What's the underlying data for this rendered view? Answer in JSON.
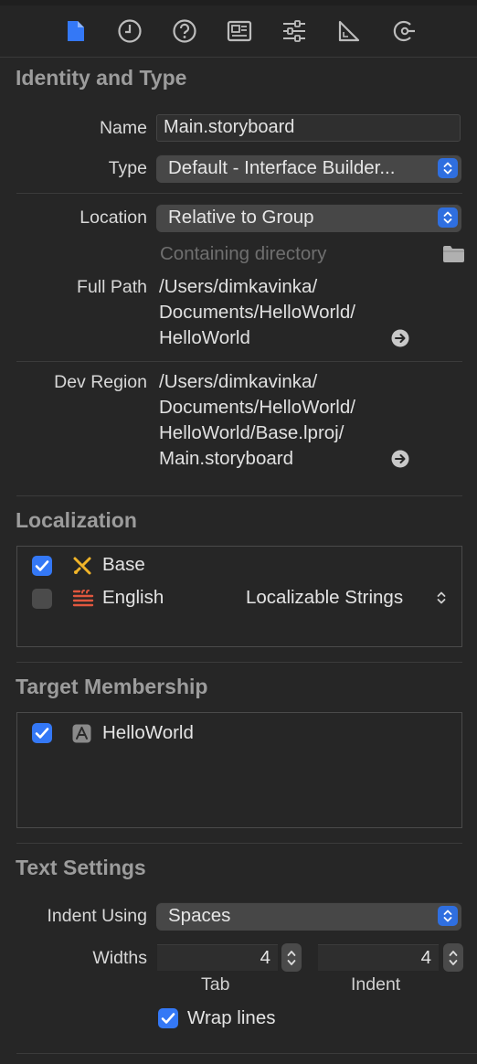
{
  "toolbar": {
    "icons": [
      "file-inspector-icon",
      "history-inspector-icon",
      "quick-help-icon",
      "identity-inspector-icon",
      "attributes-inspector-icon",
      "size-inspector-icon",
      "connections-inspector-icon"
    ],
    "active": "file-inspector-icon",
    "accent": "#3478f6"
  },
  "identity": {
    "title": "Identity and Type",
    "name_label": "Name",
    "name_value": "Main.storyboard",
    "type_label": "Type",
    "type_value": "Default - Interface Builder...",
    "location_label": "Location",
    "location_value": "Relative to Group",
    "containing_placeholder": "Containing directory",
    "full_path_label": "Full Path",
    "full_path_lines": [
      "/Users/dimkavinka/",
      "Documents/HelloWorld/",
      "HelloWorld"
    ],
    "dev_region_label": "Dev Region",
    "dev_region_lines": [
      "/Users/dimkavinka/",
      "Documents/HelloWorld/",
      "HelloWorld/Base.lproj/",
      "Main.storyboard"
    ]
  },
  "localization": {
    "title": "Localization",
    "rows": [
      {
        "label": "Base",
        "checked": true,
        "icon": "interface-builder-icon"
      },
      {
        "label": "English",
        "checked": false,
        "icon": "strings-file-icon",
        "type": "Localizable Strings"
      }
    ]
  },
  "target": {
    "title": "Target Membership",
    "rows": [
      {
        "label": "HelloWorld",
        "checked": true,
        "icon": "app-target-icon"
      }
    ]
  },
  "text_settings": {
    "title": "Text Settings",
    "indent_label": "Indent Using",
    "indent_value": "Spaces",
    "widths_label": "Widths",
    "tab_value": "4",
    "tab_label": "Tab",
    "indent_width_value": "4",
    "indent_width_label": "Indent",
    "wrap_label": "Wrap lines",
    "wrap_checked": true
  }
}
